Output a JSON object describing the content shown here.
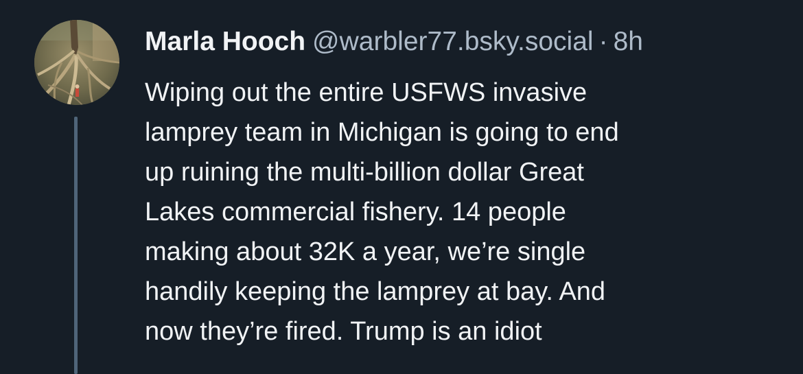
{
  "post": {
    "author_name": "Marla Hooch",
    "handle": "@warbler77.bsky.social",
    "separator": "·",
    "timestamp": "8h",
    "avatar_icon": "tree-roots-photo-avatar",
    "text_lines": [
      "Wiping out the entire USFWS invasive",
      "lamprey team in Michigan is going to end",
      "up ruining the multi-billion dollar Great",
      "Lakes commercial fishery. 14 people",
      "making about 32K a year, we’re single",
      "handily keeping the lamprey at bay. And",
      "now they’re fired. Trump is an idiot"
    ]
  },
  "theme": {
    "background": "#161e27",
    "text_primary": "#f1f3f5",
    "text_secondary": "#aebbc9",
    "thread_line": "#4f6579"
  }
}
